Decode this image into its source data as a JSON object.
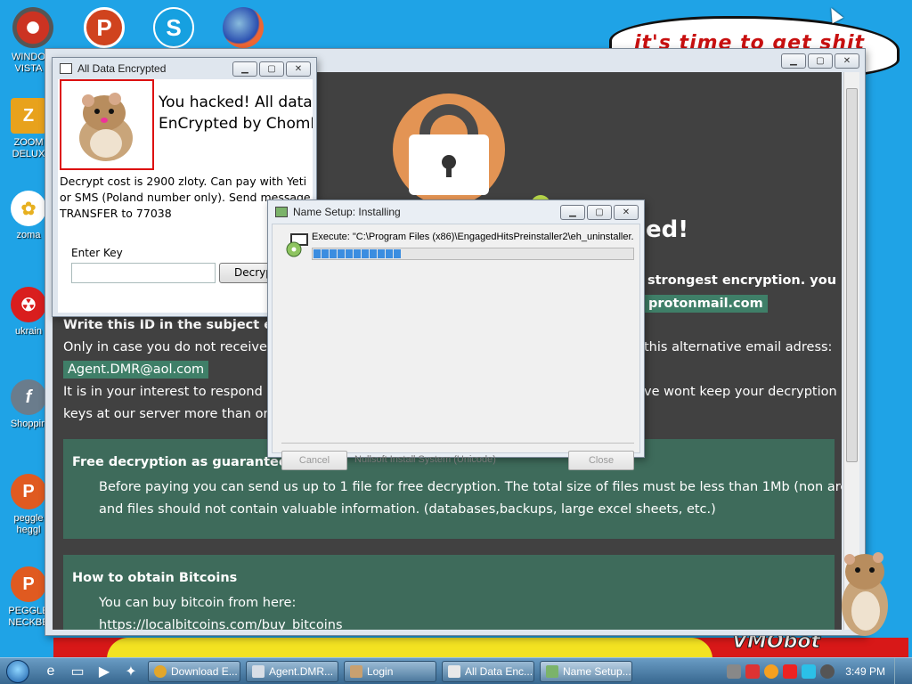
{
  "wallpaper": {
    "cloud_text": "it's time to get shit",
    "brand_text": "VMObot"
  },
  "desktop_icons": [
    {
      "name": "windows-vista-icon",
      "label": "WINDO\nVISTA",
      "color": "#c22"
    },
    {
      "name": "zoom-deluxe-icon",
      "label": "ZOOM\nDELUX",
      "color": "#e8a21c"
    },
    {
      "name": "zoma-icon",
      "label": "zoma",
      "color": "#e7d84a"
    },
    {
      "name": "ukraine-icon",
      "label": "ukrain",
      "color": "#d91e1e"
    },
    {
      "name": "shopping-icon",
      "label": "Shoppin",
      "color": "#6a7c8c"
    },
    {
      "name": "peggle-heggle-icon",
      "label": "peggle\nheggl",
      "color": "#e05a20"
    },
    {
      "name": "peggle-neckbeard-icon",
      "label": "PEGGLE\nNECKBE",
      "color": "#e05a20"
    }
  ],
  "top_icons": [
    {
      "name": "vista-ball-icon",
      "glyph": "",
      "color": "#d43"
    },
    {
      "name": "peggle-top-icon",
      "glyph": "P",
      "color": "#d0431e"
    },
    {
      "name": "skype-icon",
      "glyph": "S",
      "color": "#16a0e0"
    },
    {
      "name": "firefox-icon",
      "glyph": "",
      "color": "#2a4fb0"
    }
  ],
  "ransom_window": {
    "headline_fragment": "ed!",
    "line_strongest": "strongest encryption. you",
    "email_primary_fragment": "protonmail.com",
    "id_line": "Write this ID in the subject e-m",
    "only_in_case": "Only in case you do not receive a r",
    "alternative_email": "this alternative email adress:",
    "email_alt": "Agent.DMR@aol.com",
    "interest_line": "It is in your interest to respond as s",
    "wont_keep": "ve wont keep your decryption",
    "keys_line": "keys at our server more than one w",
    "free_decryption": {
      "heading": "Free decryption as guarantee",
      "line1": "Before paying you can send us up to 1 file for free decryption. The total size of files must be less than 1Mb (non archived),",
      "line2": "and files should not contain valuable information. (databases,backups, large excel sheets, etc.)"
    },
    "obtain_bitcoins": {
      "heading": "How to obtain Bitcoins",
      "line1": "You can buy bitcoin from here:",
      "link": "https://localbitcoins.com/buy_bitcoins"
    }
  },
  "enc_window": {
    "title": "All Data Encrypted",
    "headline_line1": "You hacked! All data",
    "headline_line2": "EnCrypted by ChomIk",
    "description": "Decrypt cost is 2900 zloty. Can pay with Yeti\nor SMS (Poland number only). Send message\nTRANSFER to 77038",
    "key_label": "Enter Key",
    "key_value": "",
    "decrypt_button": "Decrypt"
  },
  "nsis_window": {
    "title": "Name Setup: Installing",
    "execute_text": "Execute: \"C:\\Program Files (x86)\\EngagedHitsPreinstaller2\\eh_uninstaller.e",
    "progress": 0.27,
    "cancel_button": "Cancel",
    "brand": "Nullsoft Install System (Unicode)",
    "close_button": "Close"
  },
  "taskbar": {
    "buttons": [
      {
        "label": "Download E...",
        "icon_color": "#e2a62b"
      },
      {
        "label": "Agent.DMR...",
        "icon_color": "#d8dee6"
      },
      {
        "label": "Login",
        "icon_color": "#c8a070"
      },
      {
        "label": "All Data Enc...",
        "icon_color": "#e8e8e8"
      },
      {
        "label": "Name Setup...",
        "icon_color": "#7bb36a"
      }
    ],
    "clock": "3:49 PM"
  }
}
